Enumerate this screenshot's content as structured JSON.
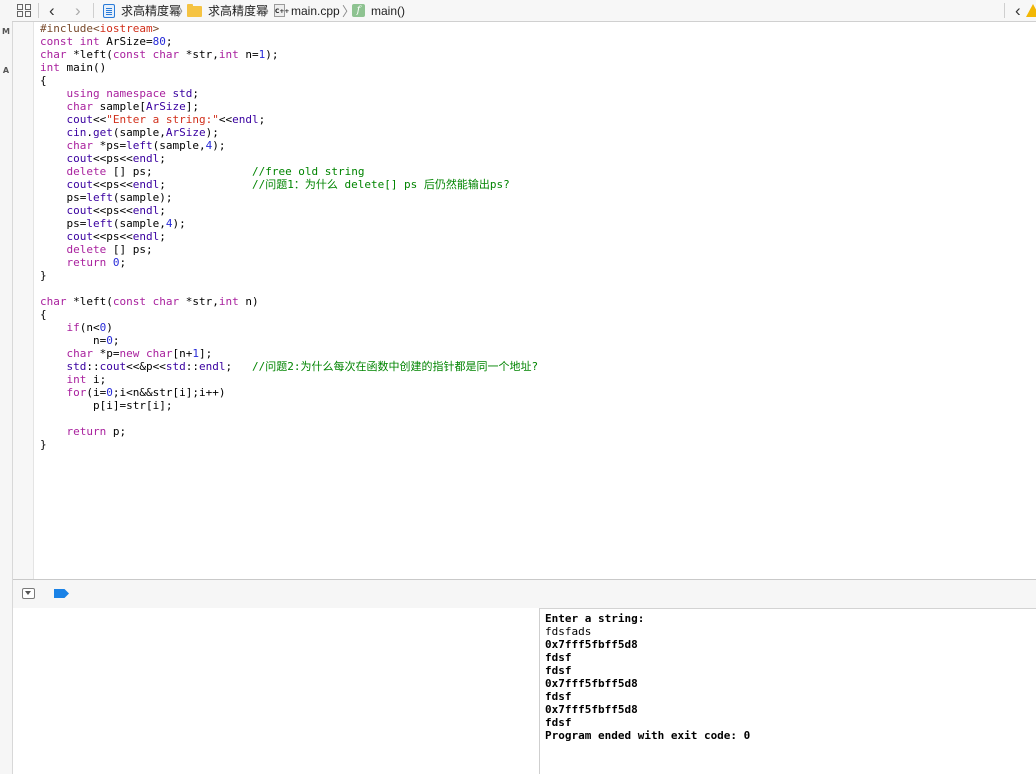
{
  "jumpbar": {
    "breadcrumbs": [
      {
        "label": "求高精度幂",
        "icon": "project-icon"
      },
      {
        "label": "求高精度幂",
        "icon": "folder-icon"
      },
      {
        "label": "main.cpp",
        "icon": "cpp-file-icon",
        "icon_text": "C++"
      },
      {
        "label": "main()",
        "icon": "function-icon",
        "icon_text": "f"
      }
    ],
    "back_glyph": "‹",
    "forward_glyph": "›",
    "right_glyph": "‹"
  },
  "left_strip": [
    "M",
    "A"
  ],
  "code_lines": [
    [
      {
        "t": "#include<",
        "c": "pp"
      },
      {
        "t": "iostream",
        "c": "str"
      },
      {
        "t": ">",
        "c": "pp"
      }
    ],
    [
      {
        "t": "const",
        "c": "kw"
      },
      {
        "t": " "
      },
      {
        "t": "int",
        "c": "kw"
      },
      {
        "t": " ArSize="
      },
      {
        "t": "80",
        "c": "num"
      },
      {
        "t": ";"
      }
    ],
    [
      {
        "t": "char",
        "c": "kw"
      },
      {
        "t": " *left("
      },
      {
        "t": "const",
        "c": "kw"
      },
      {
        "t": " "
      },
      {
        "t": "char",
        "c": "kw"
      },
      {
        "t": " *str,"
      },
      {
        "t": "int",
        "c": "kw"
      },
      {
        "t": " n="
      },
      {
        "t": "1",
        "c": "num"
      },
      {
        "t": ");"
      }
    ],
    [
      {
        "t": "int",
        "c": "kw"
      },
      {
        "t": " main()"
      }
    ],
    [
      {
        "t": "{"
      }
    ],
    [
      {
        "t": "    "
      },
      {
        "t": "using",
        "c": "kw"
      },
      {
        "t": " "
      },
      {
        "t": "namespace",
        "c": "kw"
      },
      {
        "t": " "
      },
      {
        "t": "std",
        "c": "ns"
      },
      {
        "t": ";"
      }
    ],
    [
      {
        "t": "    "
      },
      {
        "t": "char",
        "c": "kw"
      },
      {
        "t": " sample["
      },
      {
        "t": "ArSize",
        "c": "ns"
      },
      {
        "t": "];"
      }
    ],
    [
      {
        "t": "    "
      },
      {
        "t": "cout",
        "c": "ns"
      },
      {
        "t": "<<"
      },
      {
        "t": "\"Enter a string:\"",
        "c": "str"
      },
      {
        "t": "<<"
      },
      {
        "t": "endl",
        "c": "ns"
      },
      {
        "t": ";"
      }
    ],
    [
      {
        "t": "    "
      },
      {
        "t": "cin",
        "c": "ns"
      },
      {
        "t": "."
      },
      {
        "t": "get",
        "c": "ns"
      },
      {
        "t": "(sample,"
      },
      {
        "t": "ArSize",
        "c": "ns"
      },
      {
        "t": ");"
      }
    ],
    [
      {
        "t": "    "
      },
      {
        "t": "char",
        "c": "kw"
      },
      {
        "t": " *ps="
      },
      {
        "t": "left",
        "c": "ns"
      },
      {
        "t": "(sample,"
      },
      {
        "t": "4",
        "c": "num"
      },
      {
        "t": ");"
      }
    ],
    [
      {
        "t": "    "
      },
      {
        "t": "cout",
        "c": "ns"
      },
      {
        "t": "<<ps<<"
      },
      {
        "t": "endl",
        "c": "ns"
      },
      {
        "t": ";"
      }
    ],
    [
      {
        "t": "    "
      },
      {
        "t": "delete",
        "c": "kw"
      },
      {
        "t": " [] ps;               "
      },
      {
        "t": "//free old string",
        "c": "cm"
      }
    ],
    [
      {
        "t": "    "
      },
      {
        "t": "cout",
        "c": "ns"
      },
      {
        "t": "<<ps<<"
      },
      {
        "t": "endl",
        "c": "ns"
      },
      {
        "t": ";             "
      },
      {
        "t": "//问题1：为什么 delete[] ps 后仍然能输出ps?",
        "c": "cm"
      }
    ],
    [
      {
        "t": "    ps="
      },
      {
        "t": "left",
        "c": "ns"
      },
      {
        "t": "(sample);"
      }
    ],
    [
      {
        "t": "    "
      },
      {
        "t": "cout",
        "c": "ns"
      },
      {
        "t": "<<ps<<"
      },
      {
        "t": "endl",
        "c": "ns"
      },
      {
        "t": ";"
      }
    ],
    [
      {
        "t": "    ps="
      },
      {
        "t": "left",
        "c": "ns"
      },
      {
        "t": "(sample,"
      },
      {
        "t": "4",
        "c": "num"
      },
      {
        "t": ");"
      }
    ],
    [
      {
        "t": "    "
      },
      {
        "t": "cout",
        "c": "ns"
      },
      {
        "t": "<<ps<<"
      },
      {
        "t": "endl",
        "c": "ns"
      },
      {
        "t": ";"
      }
    ],
    [
      {
        "t": "    "
      },
      {
        "t": "delete",
        "c": "kw"
      },
      {
        "t": " [] ps;"
      }
    ],
    [
      {
        "t": "    "
      },
      {
        "t": "return",
        "c": "kw"
      },
      {
        "t": " "
      },
      {
        "t": "0",
        "c": "num"
      },
      {
        "t": ";"
      }
    ],
    [
      {
        "t": "}"
      }
    ],
    [
      {
        "t": ""
      }
    ],
    [
      {
        "t": "char",
        "c": "kw"
      },
      {
        "t": " *left("
      },
      {
        "t": "const",
        "c": "kw"
      },
      {
        "t": " "
      },
      {
        "t": "char",
        "c": "kw"
      },
      {
        "t": " *str,"
      },
      {
        "t": "int",
        "c": "kw"
      },
      {
        "t": " n)"
      }
    ],
    [
      {
        "t": "{"
      }
    ],
    [
      {
        "t": "    "
      },
      {
        "t": "if",
        "c": "kw"
      },
      {
        "t": "(n<"
      },
      {
        "t": "0",
        "c": "num"
      },
      {
        "t": ")"
      }
    ],
    [
      {
        "t": "        n="
      },
      {
        "t": "0",
        "c": "num"
      },
      {
        "t": ";"
      }
    ],
    [
      {
        "t": "    "
      },
      {
        "t": "char",
        "c": "kw"
      },
      {
        "t": " *p="
      },
      {
        "t": "new",
        "c": "kw"
      },
      {
        "t": " "
      },
      {
        "t": "char",
        "c": "kw"
      },
      {
        "t": "[n+"
      },
      {
        "t": "1",
        "c": "num"
      },
      {
        "t": "];"
      }
    ],
    [
      {
        "t": "    "
      },
      {
        "t": "std",
        "c": "ns"
      },
      {
        "t": "::"
      },
      {
        "t": "cout",
        "c": "ns"
      },
      {
        "t": "<<&p<<"
      },
      {
        "t": "std",
        "c": "ns"
      },
      {
        "t": "::"
      },
      {
        "t": "endl",
        "c": "ns"
      },
      {
        "t": ";   "
      },
      {
        "t": "//问题2:为什么每次在函数中创建的指针都是同一个地址?",
        "c": "cm"
      }
    ],
    [
      {
        "t": "    "
      },
      {
        "t": "int",
        "c": "kw"
      },
      {
        "t": " i;"
      }
    ],
    [
      {
        "t": "    "
      },
      {
        "t": "for",
        "c": "kw"
      },
      {
        "t": "(i="
      },
      {
        "t": "0",
        "c": "num"
      },
      {
        "t": ";i<n&&str[i];i++)"
      }
    ],
    [
      {
        "t": "        p[i]=str[i];"
      }
    ],
    [
      {
        "t": ""
      }
    ],
    [
      {
        "t": "    "
      },
      {
        "t": "return",
        "c": "kw"
      },
      {
        "t": " p;"
      }
    ],
    [
      {
        "t": "}"
      }
    ]
  ],
  "console_lines": [
    {
      "text": "Enter a string:",
      "bold": true
    },
    {
      "text": "fdsfads",
      "bold": false
    },
    {
      "text": "0x7fff5fbff5d8",
      "bold": true
    },
    {
      "text": "fdsf",
      "bold": true
    },
    {
      "text": "fdsf",
      "bold": true
    },
    {
      "text": "0x7fff5fbff5d8",
      "bold": true
    },
    {
      "text": "fdsf",
      "bold": true
    },
    {
      "text": "0x7fff5fbff5d8",
      "bold": true
    },
    {
      "text": "fdsf",
      "bold": true
    },
    {
      "text": "Program ended with exit code: 0",
      "bold": true
    }
  ],
  "colors": {
    "keyword": "#a9219e",
    "string": "#d12f1b",
    "number": "#272ad8",
    "preprocessor": "#78492a",
    "identifier": "#3900a0",
    "comment": "#008400",
    "breakpoint": "#1a82e6"
  }
}
